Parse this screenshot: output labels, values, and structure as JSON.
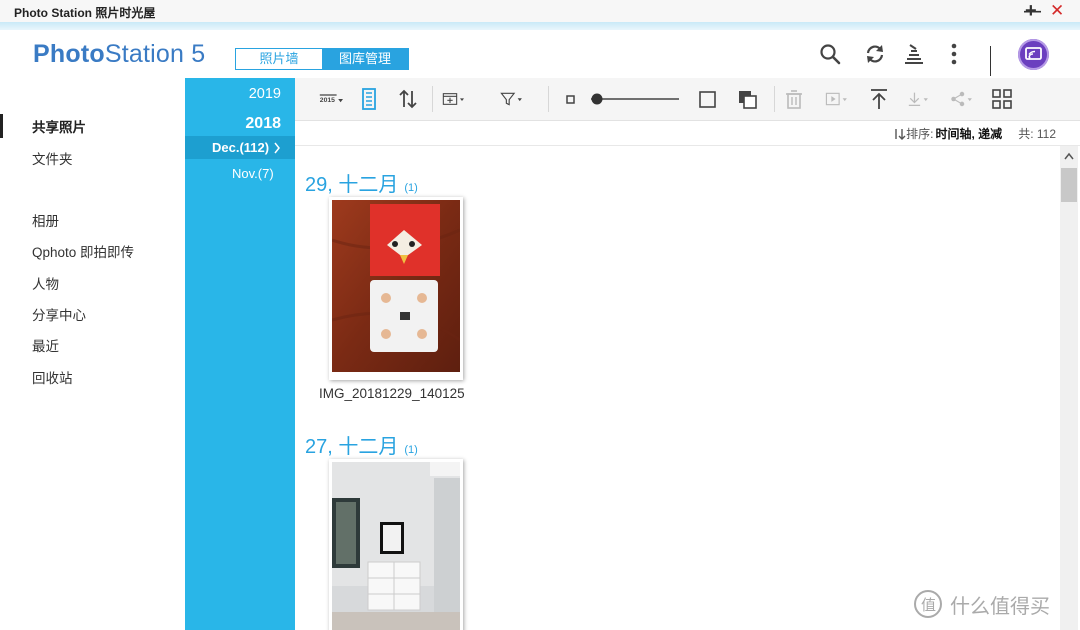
{
  "window": {
    "title": "Photo Station 照片时光屋"
  },
  "header": {
    "logo_bold": "Photo",
    "logo_rest": "Station 5",
    "tabs": [
      {
        "label": "照片墙",
        "active": false
      },
      {
        "label": "图库管理",
        "active": true
      }
    ]
  },
  "sidebar": {
    "items": [
      {
        "label": "共享照片",
        "active": true
      },
      {
        "label": "文件夹"
      },
      {
        "label": "相册"
      },
      {
        "label": "Qphoto 即拍即传"
      },
      {
        "label": "人物"
      },
      {
        "label": "分享中心"
      },
      {
        "label": "最近"
      },
      {
        "label": "回收站"
      }
    ]
  },
  "timeline": {
    "years": [
      "2019",
      "2018"
    ],
    "months": [
      {
        "label": "Dec.(112)",
        "active": true
      },
      {
        "label": "Nov.(7)",
        "active": false
      }
    ]
  },
  "toolbar": {
    "year_icon_text": "2015"
  },
  "sortbar": {
    "label": "排序:",
    "value": "时间轴, 递减",
    "total": "共: 112"
  },
  "groups": [
    {
      "date": "29, 十二月",
      "count": "(1)",
      "photos": [
        {
          "name": "IMG_20181229_140125"
        }
      ]
    },
    {
      "date": "27, 十二月",
      "count": "(1)",
      "photos": [
        {
          "name": ""
        }
      ]
    }
  ],
  "watermark": "什么值得买",
  "colors": {
    "accent": "#29a3e0",
    "timeline": "#29b6e8",
    "logo": "#3a7bc4"
  }
}
